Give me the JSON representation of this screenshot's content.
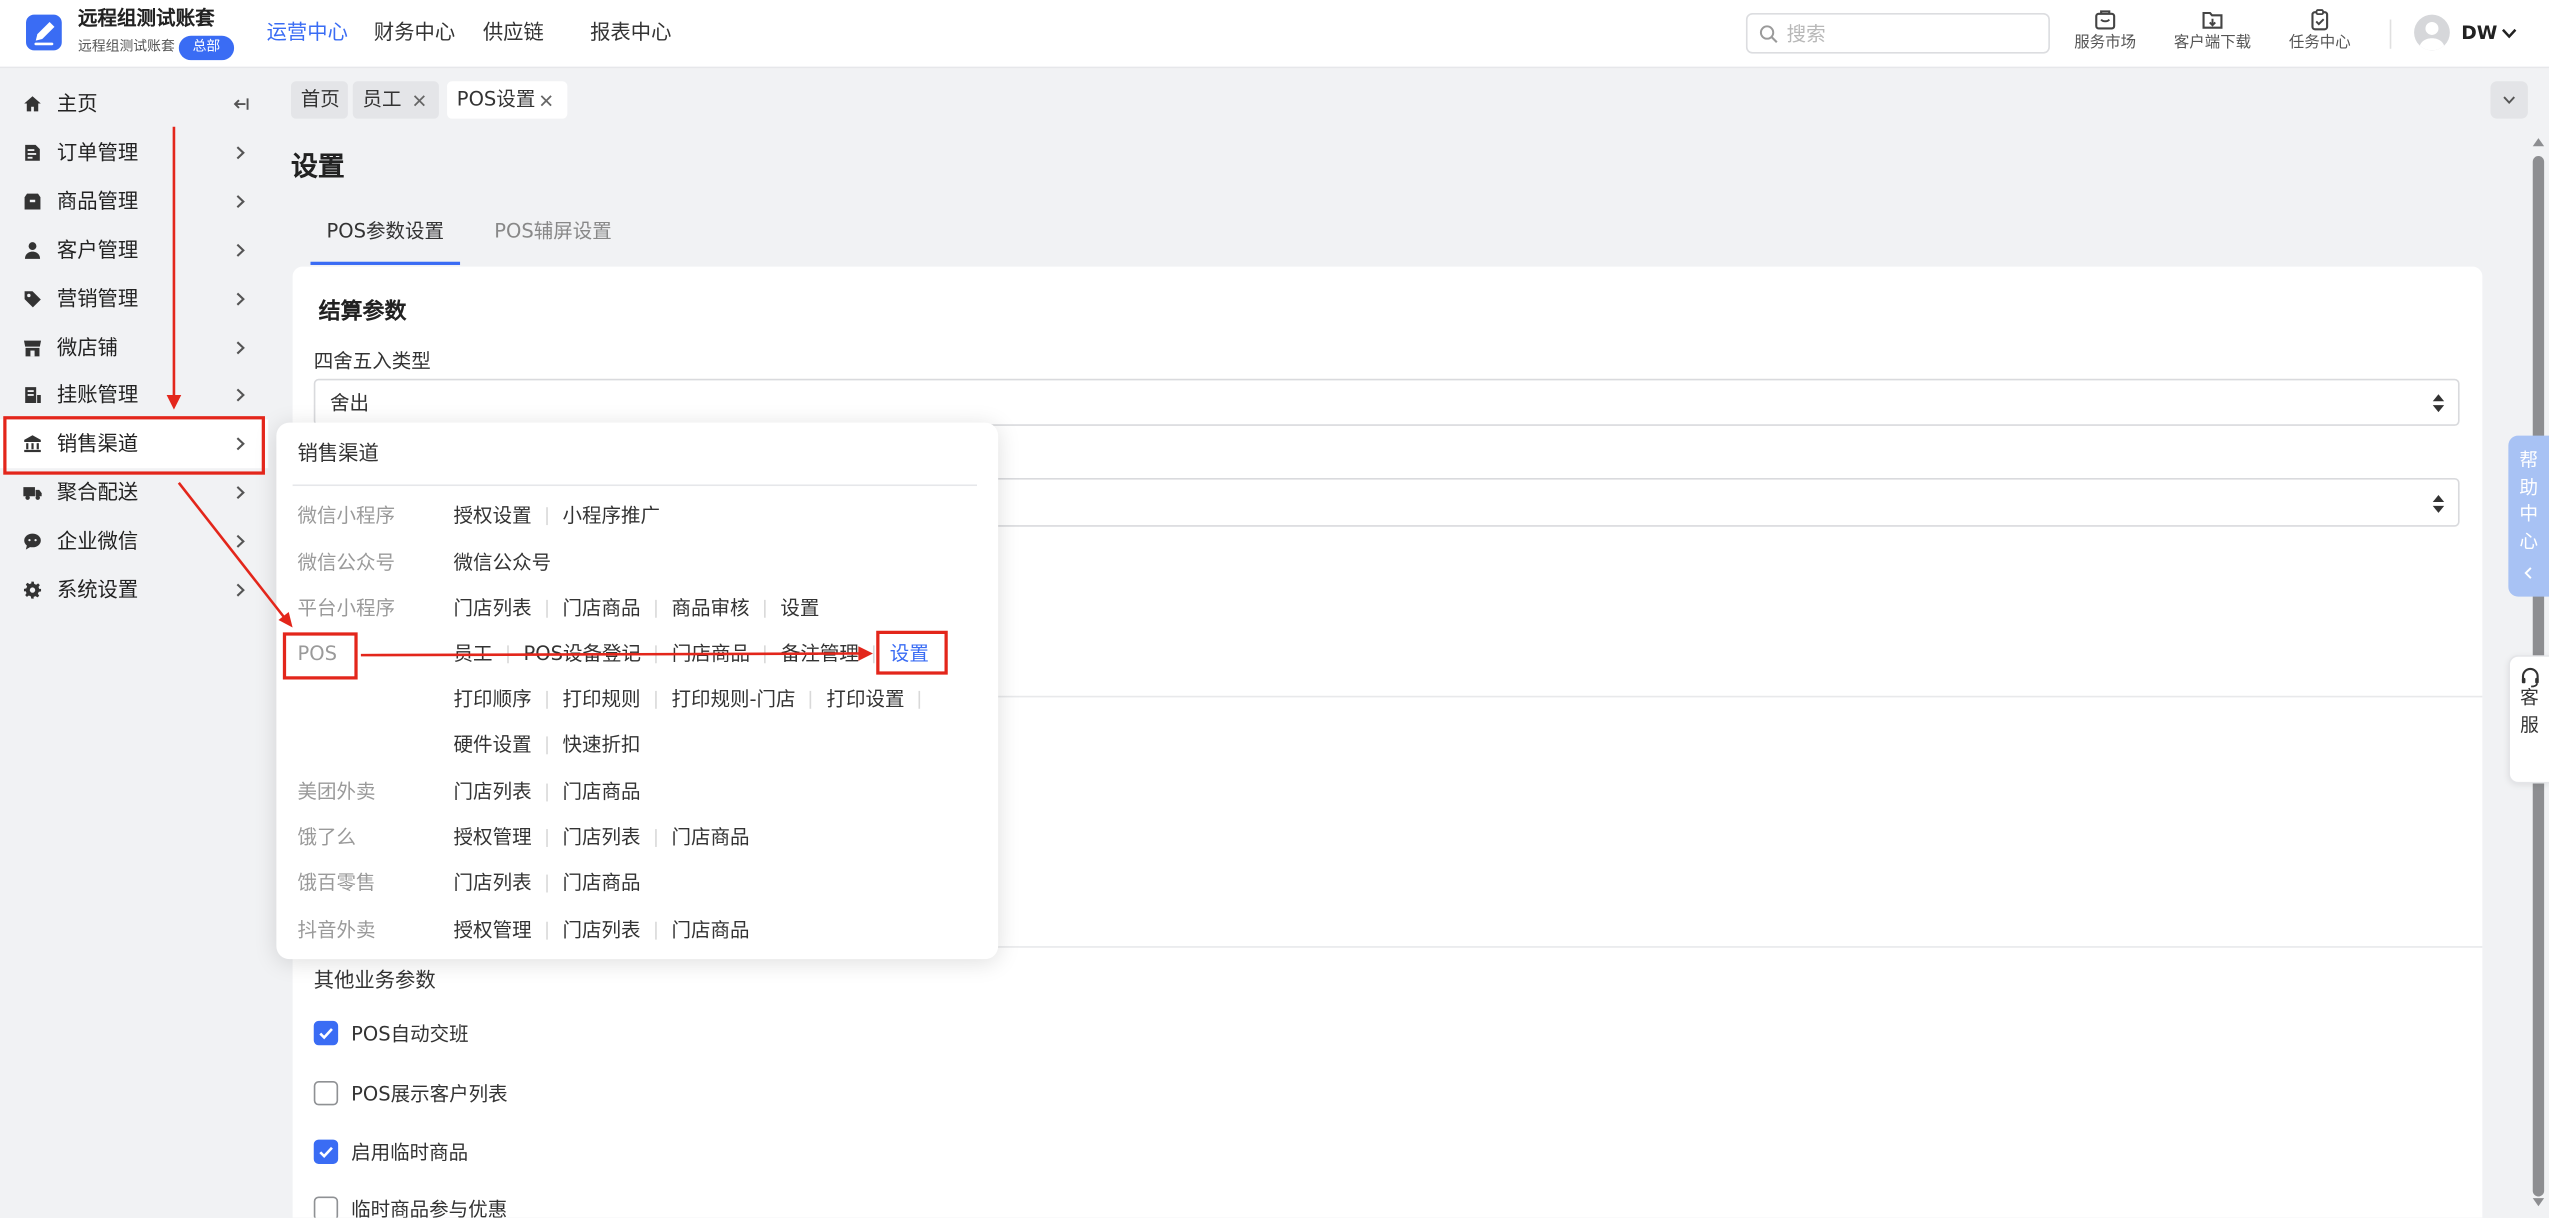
{
  "colors": {
    "accent": "#3a6cf4",
    "annotation": "#e3261b",
    "help_tab": "#a8c2f4"
  },
  "app": {
    "title": "远程组测试账套",
    "subtitle": "远程组测试账套",
    "badge": "总部",
    "logo_icon": "app-logo-icon"
  },
  "topnav": [
    {
      "label": "运营中心",
      "active": true
    },
    {
      "label": "财务中心",
      "active": false
    },
    {
      "label": "供应链",
      "active": false
    },
    {
      "label": "报表中心",
      "active": false
    }
  ],
  "search": {
    "placeholder": "搜索",
    "icon": "search-icon"
  },
  "header_actions": [
    {
      "label": "服务市场",
      "icon": "service-market-icon"
    },
    {
      "label": "客户端下载",
      "icon": "client-download-icon"
    },
    {
      "label": "任务中心",
      "icon": "task-center-icon"
    }
  ],
  "user": {
    "name": "DW",
    "icon": "avatar-icon"
  },
  "sidebar": {
    "items": [
      {
        "label": "主页",
        "icon": "home-icon",
        "highlighted": false
      },
      {
        "label": "订单管理",
        "icon": "order-icon",
        "highlighted": false
      },
      {
        "label": "商品管理",
        "icon": "goods-icon",
        "highlighted": false
      },
      {
        "label": "客户管理",
        "icon": "customer-icon",
        "highlighted": false
      },
      {
        "label": "营销管理",
        "icon": "tag-icon",
        "highlighted": false
      },
      {
        "label": "微店铺",
        "icon": "shop-icon",
        "highlighted": false
      },
      {
        "label": "挂账管理",
        "icon": "ledger-icon",
        "highlighted": false
      },
      {
        "label": "销售渠道",
        "icon": "bank-icon",
        "highlighted": true
      },
      {
        "label": "聚合配送",
        "icon": "truck-icon",
        "highlighted": false
      },
      {
        "label": "企业微信",
        "icon": "chat-icon",
        "highlighted": false
      },
      {
        "label": "系统设置",
        "icon": "gear-icon",
        "highlighted": false
      }
    ]
  },
  "tabs": [
    {
      "label": "首页",
      "active": false
    },
    {
      "label": "员工",
      "active": false
    },
    {
      "label": "POS设置",
      "active": true
    }
  ],
  "page": {
    "title": "设置",
    "subtabs": [
      {
        "label": "POS参数设置",
        "active": true
      },
      {
        "label": "POS辅屏设置",
        "active": false
      }
    ]
  },
  "settlement": {
    "heading": "结算参数",
    "rounding": {
      "label": "四舍五入类型",
      "value": "舍出"
    }
  },
  "other_params": {
    "heading": "其他业务参数",
    "options": [
      {
        "label": "POS自动交班",
        "checked": true
      },
      {
        "label": "POS展示客户列表",
        "checked": false
      },
      {
        "label": "启用临时商品",
        "checked": true
      },
      {
        "label": "临时商品参与优惠",
        "checked": false
      }
    ]
  },
  "channel_menu": {
    "title": "销售渠道",
    "groups": [
      {
        "name": "微信小程序",
        "links": [
          "授权设置",
          "小程序推广"
        ]
      },
      {
        "name": "微信公众号",
        "links": [
          "微信公众号"
        ]
      },
      {
        "name": "平台小程序",
        "links": [
          "门店列表",
          "门店商品",
          "商品审核",
          "设置"
        ]
      },
      {
        "name": "POS",
        "links": [
          "员工",
          "POS设备登记",
          "门店商品",
          "备注管理",
          "设置",
          "打印顺序",
          "打印规则",
          "打印规则-门店",
          "打印设置",
          "硬件设置",
          "快速折扣"
        ]
      },
      {
        "name": "美团外卖",
        "links": [
          "门店列表",
          "门店商品"
        ]
      },
      {
        "name": "饿了么",
        "links": [
          "授权管理",
          "门店列表",
          "门店商品"
        ]
      },
      {
        "name": "饿百零售",
        "links": [
          "门店列表",
          "门店商品"
        ]
      },
      {
        "name": "抖音外卖",
        "links": [
          "授权管理",
          "门店列表",
          "门店商品"
        ]
      }
    ]
  },
  "floaters": {
    "help": "帮助中心",
    "service": "客服"
  }
}
